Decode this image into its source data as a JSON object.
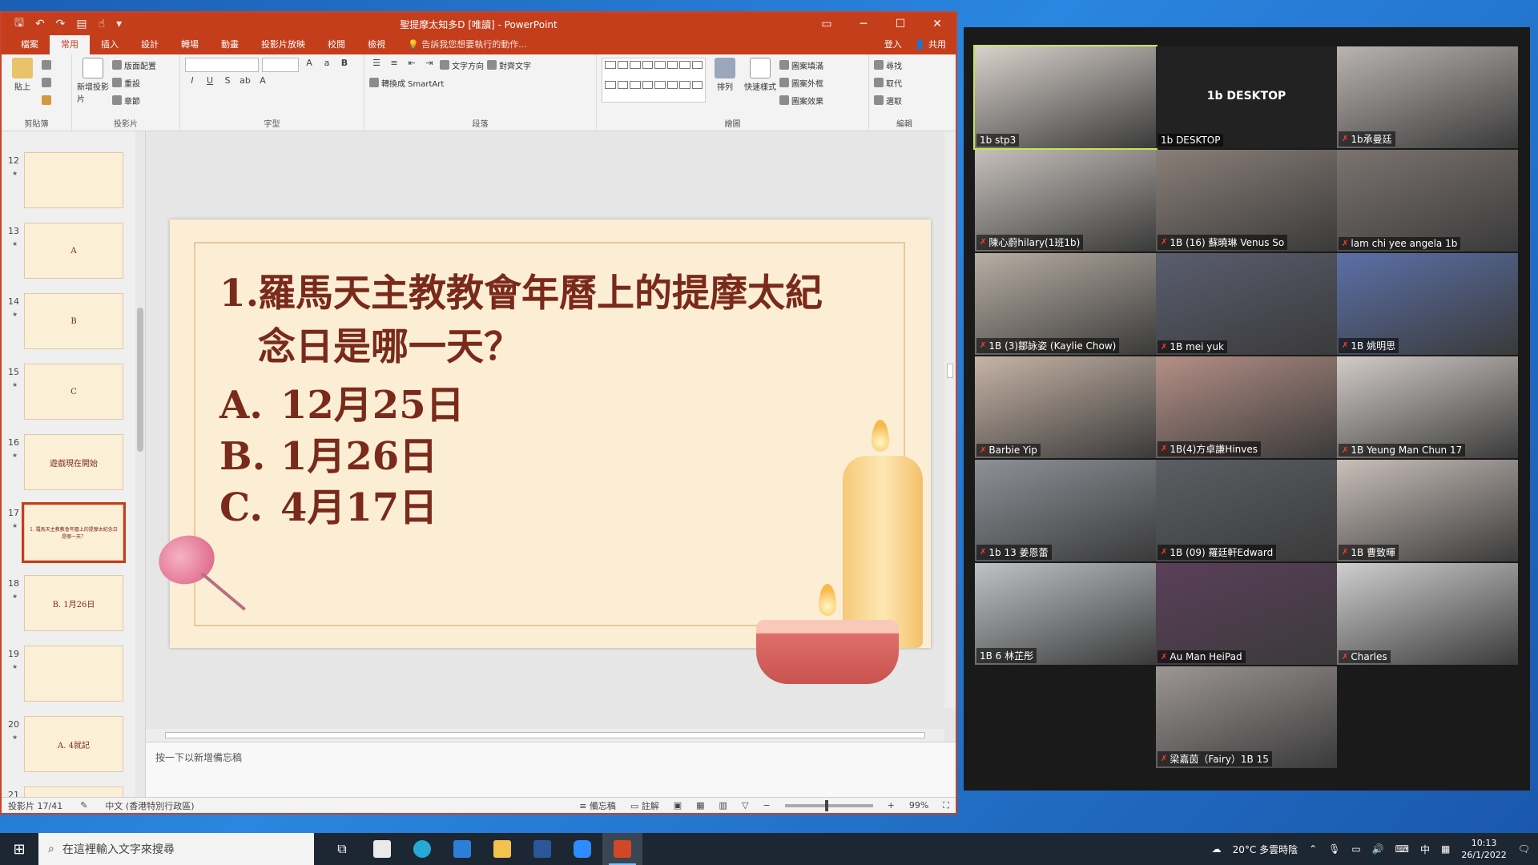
{
  "window": {
    "title": "聖提摩太知多D [唯讀] - PowerPoint",
    "qat": [
      "save",
      "undo",
      "redo",
      "present",
      "touch"
    ]
  },
  "ribbon": {
    "tabs": [
      "檔案",
      "常用",
      "插入",
      "設計",
      "轉場",
      "動畫",
      "投影片放映",
      "校閱",
      "檢視"
    ],
    "active_tab": "常用",
    "tell_me": "告訴我您想要執行的動作...",
    "sign_in": "登入",
    "share": "共用",
    "groups": [
      "剪貼簿",
      "投影片",
      "字型",
      "段落",
      "繪圖",
      "編輯"
    ],
    "paste": "貼上",
    "new_slide": "新增投影片",
    "layout": "版面配置",
    "reset": "重設",
    "section": "章節",
    "text_direction": "文字方向",
    "align_text": "對齊文字",
    "smartart": "轉換成 SmartArt",
    "arrange": "排列",
    "quick_styles": "快速樣式",
    "shape_fill": "圖案填滿",
    "shape_outline": "圖案外框",
    "shape_effects": "圖案效果",
    "find": "尋找",
    "replace": "取代",
    "select": "選取"
  },
  "thumbnails": [
    {
      "num": "12",
      "text": ""
    },
    {
      "num": "13",
      "text": "A"
    },
    {
      "num": "14",
      "text": "B"
    },
    {
      "num": "15",
      "text": "C"
    },
    {
      "num": "16",
      "text": "遊戲現在開始"
    },
    {
      "num": "17",
      "text": "1. 羅馬天主教教會年曆上的提摩太紀念日是哪一天？"
    },
    {
      "num": "18",
      "text": "B. 1月26日"
    },
    {
      "num": "19",
      "text": ""
    },
    {
      "num": "20",
      "text": "A. 4就記"
    },
    {
      "num": "21",
      "text": ""
    }
  ],
  "slide": {
    "question_number": "1.",
    "question": "羅馬天主教教會年曆上的提摩太紀念日是哪一天？",
    "options": [
      {
        "letter": "A.",
        "text": "12月25日"
      },
      {
        "letter": "B.",
        "text": "1月26日"
      },
      {
        "letter": "C.",
        "text": "4月17日"
      }
    ]
  },
  "notes_placeholder": "按一下以新增備忘稿",
  "status": {
    "slide": "投影片 17/41",
    "language": "中文 (香港特別行政區)",
    "notes": "備忘稿",
    "comments": "註解",
    "zoom": "99%"
  },
  "zoom_participants": [
    {
      "name": "1b stp3",
      "desktop": false,
      "color": "#d9d2cc"
    },
    {
      "name": "1b DESKTOP",
      "desktop": true,
      "color": "#222222"
    },
    {
      "name": "1b承曼廷",
      "desktop": false,
      "color": "#b9b4b1"
    },
    {
      "name": "陳心蔚hilary(1班1b)",
      "desktop": false,
      "color": "#c6c0bb"
    },
    {
      "name": "1B (16) 蘇曉琳 Venus So",
      "desktop": false,
      "color": "#8a7f78"
    },
    {
      "name": "lam chi yee angela 1b",
      "desktop": false,
      "color": "#7b7370"
    },
    {
      "name": "1B (3)鄒詠姿 (Kaylie Chow)",
      "desktop": false,
      "color": "#b8aea4"
    },
    {
      "name": "1B mei yuk",
      "desktop": false,
      "color": "#5a5d6f"
    },
    {
      "name": "1B 姚明思",
      "desktop": false,
      "color": "#5b70a8"
    },
    {
      "name": "Barbie Yip",
      "desktop": false,
      "color": "#c7b4a6"
    },
    {
      "name": "1B(4)方卓謙Hinves",
      "desktop": false,
      "color": "#b58f86"
    },
    {
      "name": "1B Yeung Man Chun 17",
      "desktop": false,
      "color": "#d2ccc8"
    },
    {
      "name": "1b 13 姜恩蕾",
      "desktop": false,
      "color": "#8d9198"
    },
    {
      "name": "1B (09) 羅廷軒Edward",
      "desktop": false,
      "color": "#5b5e63"
    },
    {
      "name": "1B 曹致暉",
      "desktop": false,
      "color": "#c9bfb9"
    },
    {
      "name": "1B 6 林芷彤",
      "desktop": false,
      "color": "#bfc3c6"
    },
    {
      "name": "Au Man HeiPad",
      "desktop": false,
      "color": "#5b3f5a"
    },
    {
      "name": "Charles",
      "desktop": false,
      "color": "#cfcfcf"
    },
    {
      "name": "梁嘉茵（Fairy）1B 15",
      "desktop": false,
      "color": "#9c9694"
    }
  ],
  "taskbar": {
    "search_placeholder": "在這裡輸入文字來搜尋",
    "weather": "20°C 多雲時陰",
    "ime": "中",
    "time": "10:13",
    "date": "26/1/2022"
  },
  "colors": {
    "accent": "#c43e1c",
    "slide_text": "#7a2a1a",
    "slide_bg": "#fbeed5"
  }
}
